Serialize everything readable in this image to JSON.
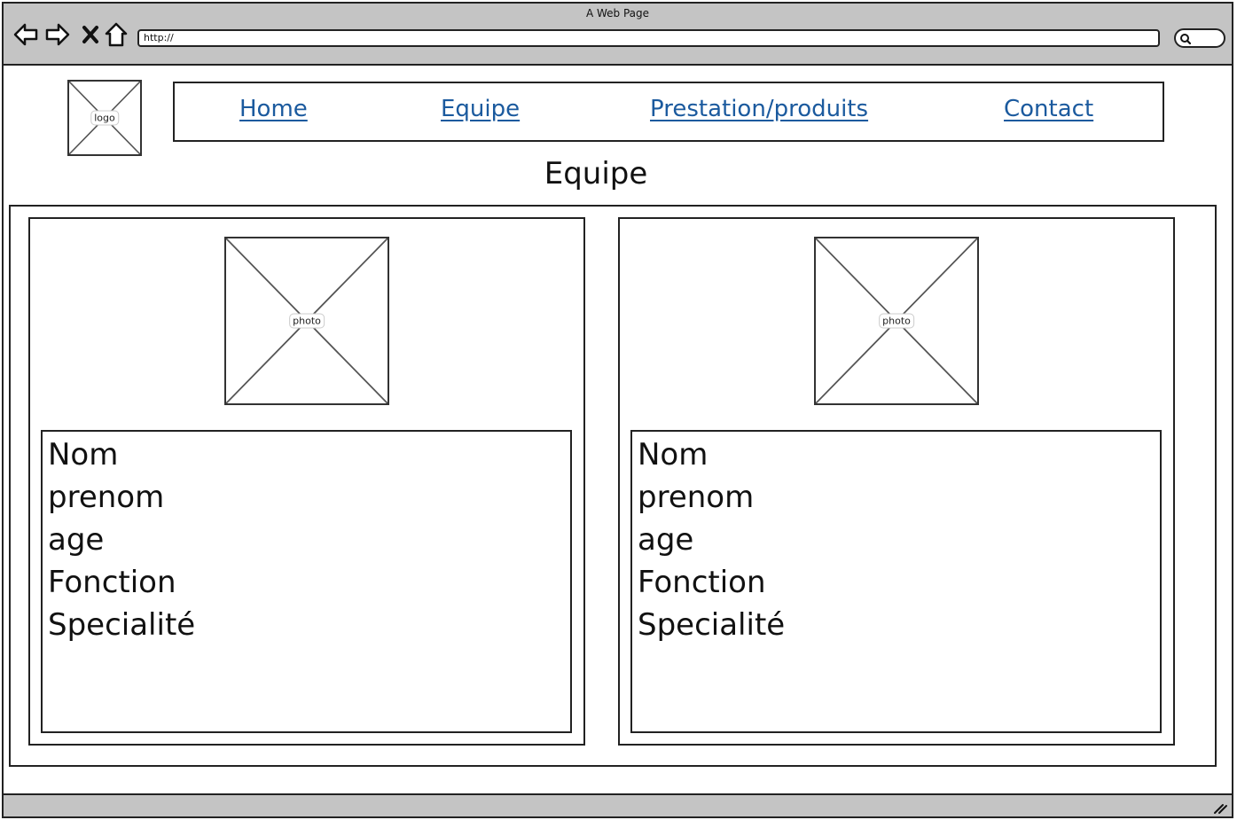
{
  "window": {
    "title": "A Web Page"
  },
  "address_bar": {
    "value": "http://"
  },
  "icons": {
    "back": "back-arrow-icon",
    "forward": "forward-arrow-icon",
    "stop": "close-icon",
    "home": "home-icon",
    "search": "search-icon",
    "resize": "resize-grip-icon"
  },
  "logo": {
    "label": "logo"
  },
  "nav": {
    "items": [
      {
        "label": "Home"
      },
      {
        "label": "Equipe"
      },
      {
        "label": "Prestation/produits"
      },
      {
        "label": "Contact"
      }
    ]
  },
  "page": {
    "title": "Equipe"
  },
  "members": [
    {
      "photo_label": "photo",
      "fields": [
        "Nom",
        "prenom",
        "age",
        "Fonction",
        "Specialité"
      ]
    },
    {
      "photo_label": "photo",
      "fields": [
        "Nom",
        "prenom",
        "age",
        "Fonction",
        "Specialité"
      ]
    }
  ],
  "colors": {
    "chrome": "#c4c4c4",
    "link": "#1b5a9e",
    "stroke": "#222222"
  }
}
